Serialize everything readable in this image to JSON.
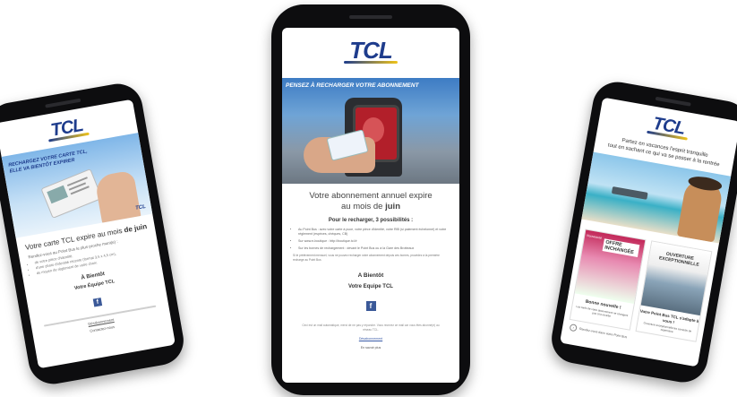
{
  "brand": {
    "logo": "TCL",
    "blue": "#1e3c8c",
    "yellow": "#f0c419",
    "facebook_blue": "#3b5998"
  },
  "left_phone": {
    "banner": "RECHARGEZ VOTRE CARTE TCL, ELLE VA BIENTÔT EXPIRER",
    "headline_part1": "Votre carte TCL expire au mois ",
    "headline_part2": "de juin",
    "intro": "Rendez-vous au Point Bus le plus proche muni(e) :",
    "bullets": [
      "de votre pièce d'identité,",
      "d'une photo d'identité récente (format 3,5 x 4,5 cm),",
      "du moyen de règlement de votre choix."
    ],
    "farewell": "À Bientôt",
    "signature": "Votre Équipe TCL",
    "facebook": "f",
    "footer_link": "Désabonnement",
    "footer_small": "Contactez-nous"
  },
  "center_phone": {
    "banner": "PENSEZ À RECHARGER VOTRE ABONNEMENT",
    "headline_line1": "Votre abonnement annuel expire",
    "headline_line2_prefix": "au mois de ",
    "headline_line2_bold": "juin",
    "subhead": "Pour le recharger, 3 possibilités :",
    "bullets": [
      "Au Point Bus : avec votre carte à puce, votre pièce d'identité, votre RIB (si paiement échelonné) et votre règlement (espèces, chèques, CB)",
      "Sur www.e-boutique : http://boutique.tcl.fr",
      "Sur les bornes de rechargement : devant le Point Bus ou à la Gare des Brotteaux"
    ],
    "note": "Si le prélèvement mensuel, vous ne pouvez recharger votre abonnement depuis ces bornes, procédez à la première recharge au Point Bus",
    "farewell": "A Bientôt",
    "signature": "Votre Equipe TCL",
    "facebook": "f",
    "footer_text": "Ceci est un mail automatique, merci de ne pas y répondre. Vous recevez ce mail car vous êtes abonné(e) au réseau TCL.",
    "footer_link": "Désabonnement",
    "footer_link2": "En savoir plus"
  },
  "right_phone": {
    "intro_line1": "Partez en vacances l'esprit tranquille",
    "intro_line2": "tout en sachant ce qui va se passer à la rentrée",
    "tile1_badge": "OFFRE INCHANGÉE",
    "tile1_tag": "Bonne nouvelle !",
    "tile1_caption": "Les tarifs de votre abonnement ne changent pas à la rentrée",
    "tile2_badge": "OUVERTURE EXCEPTIONNELLE",
    "tile2_tag": "Votre Point Bus TCL s'adapte à vous !",
    "tile2_caption": "Ouverture exceptionnelle les samedis de septembre",
    "side_label": "Nouveauté",
    "link_text": "Rendez-vous dans votre Point Bus"
  }
}
